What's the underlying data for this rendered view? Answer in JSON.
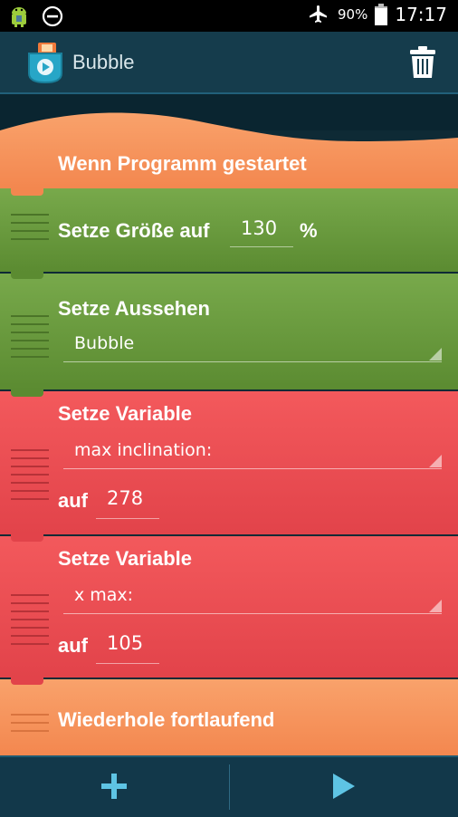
{
  "status_bar": {
    "battery_percent": "90%",
    "time": "17:17",
    "icons": [
      "android-debug-icon",
      "do-not-disturb-icon",
      "airplane-mode-icon",
      "battery-icon"
    ]
  },
  "action_bar": {
    "title": "Bubble",
    "app_icon": "pocket-code-icon",
    "delete_icon": "trash-icon"
  },
  "bricks": {
    "start": {
      "label": "Wenn Programm gestartet"
    },
    "set_size": {
      "label": "Setze Größe auf",
      "value": "130",
      "unit": "%"
    },
    "set_look": {
      "label": "Setze Aussehen",
      "selected": "Bubble"
    },
    "set_var1": {
      "label": "Setze Variable",
      "variable": "max inclination:",
      "to_label": "auf",
      "value": "278"
    },
    "set_var2": {
      "label": "Setze Variable",
      "variable": "x max:",
      "to_label": "auf",
      "value": "105"
    },
    "forever": {
      "label": "Wiederhole fortlaufend"
    }
  },
  "bottom_bar": {
    "add_icon": "plus-icon",
    "play_icon": "play-icon"
  },
  "colors": {
    "event_orange": "#f3874f",
    "looks_green": "#5b8b31",
    "data_red": "#e2434a",
    "bar_blue": "#153c4c"
  }
}
